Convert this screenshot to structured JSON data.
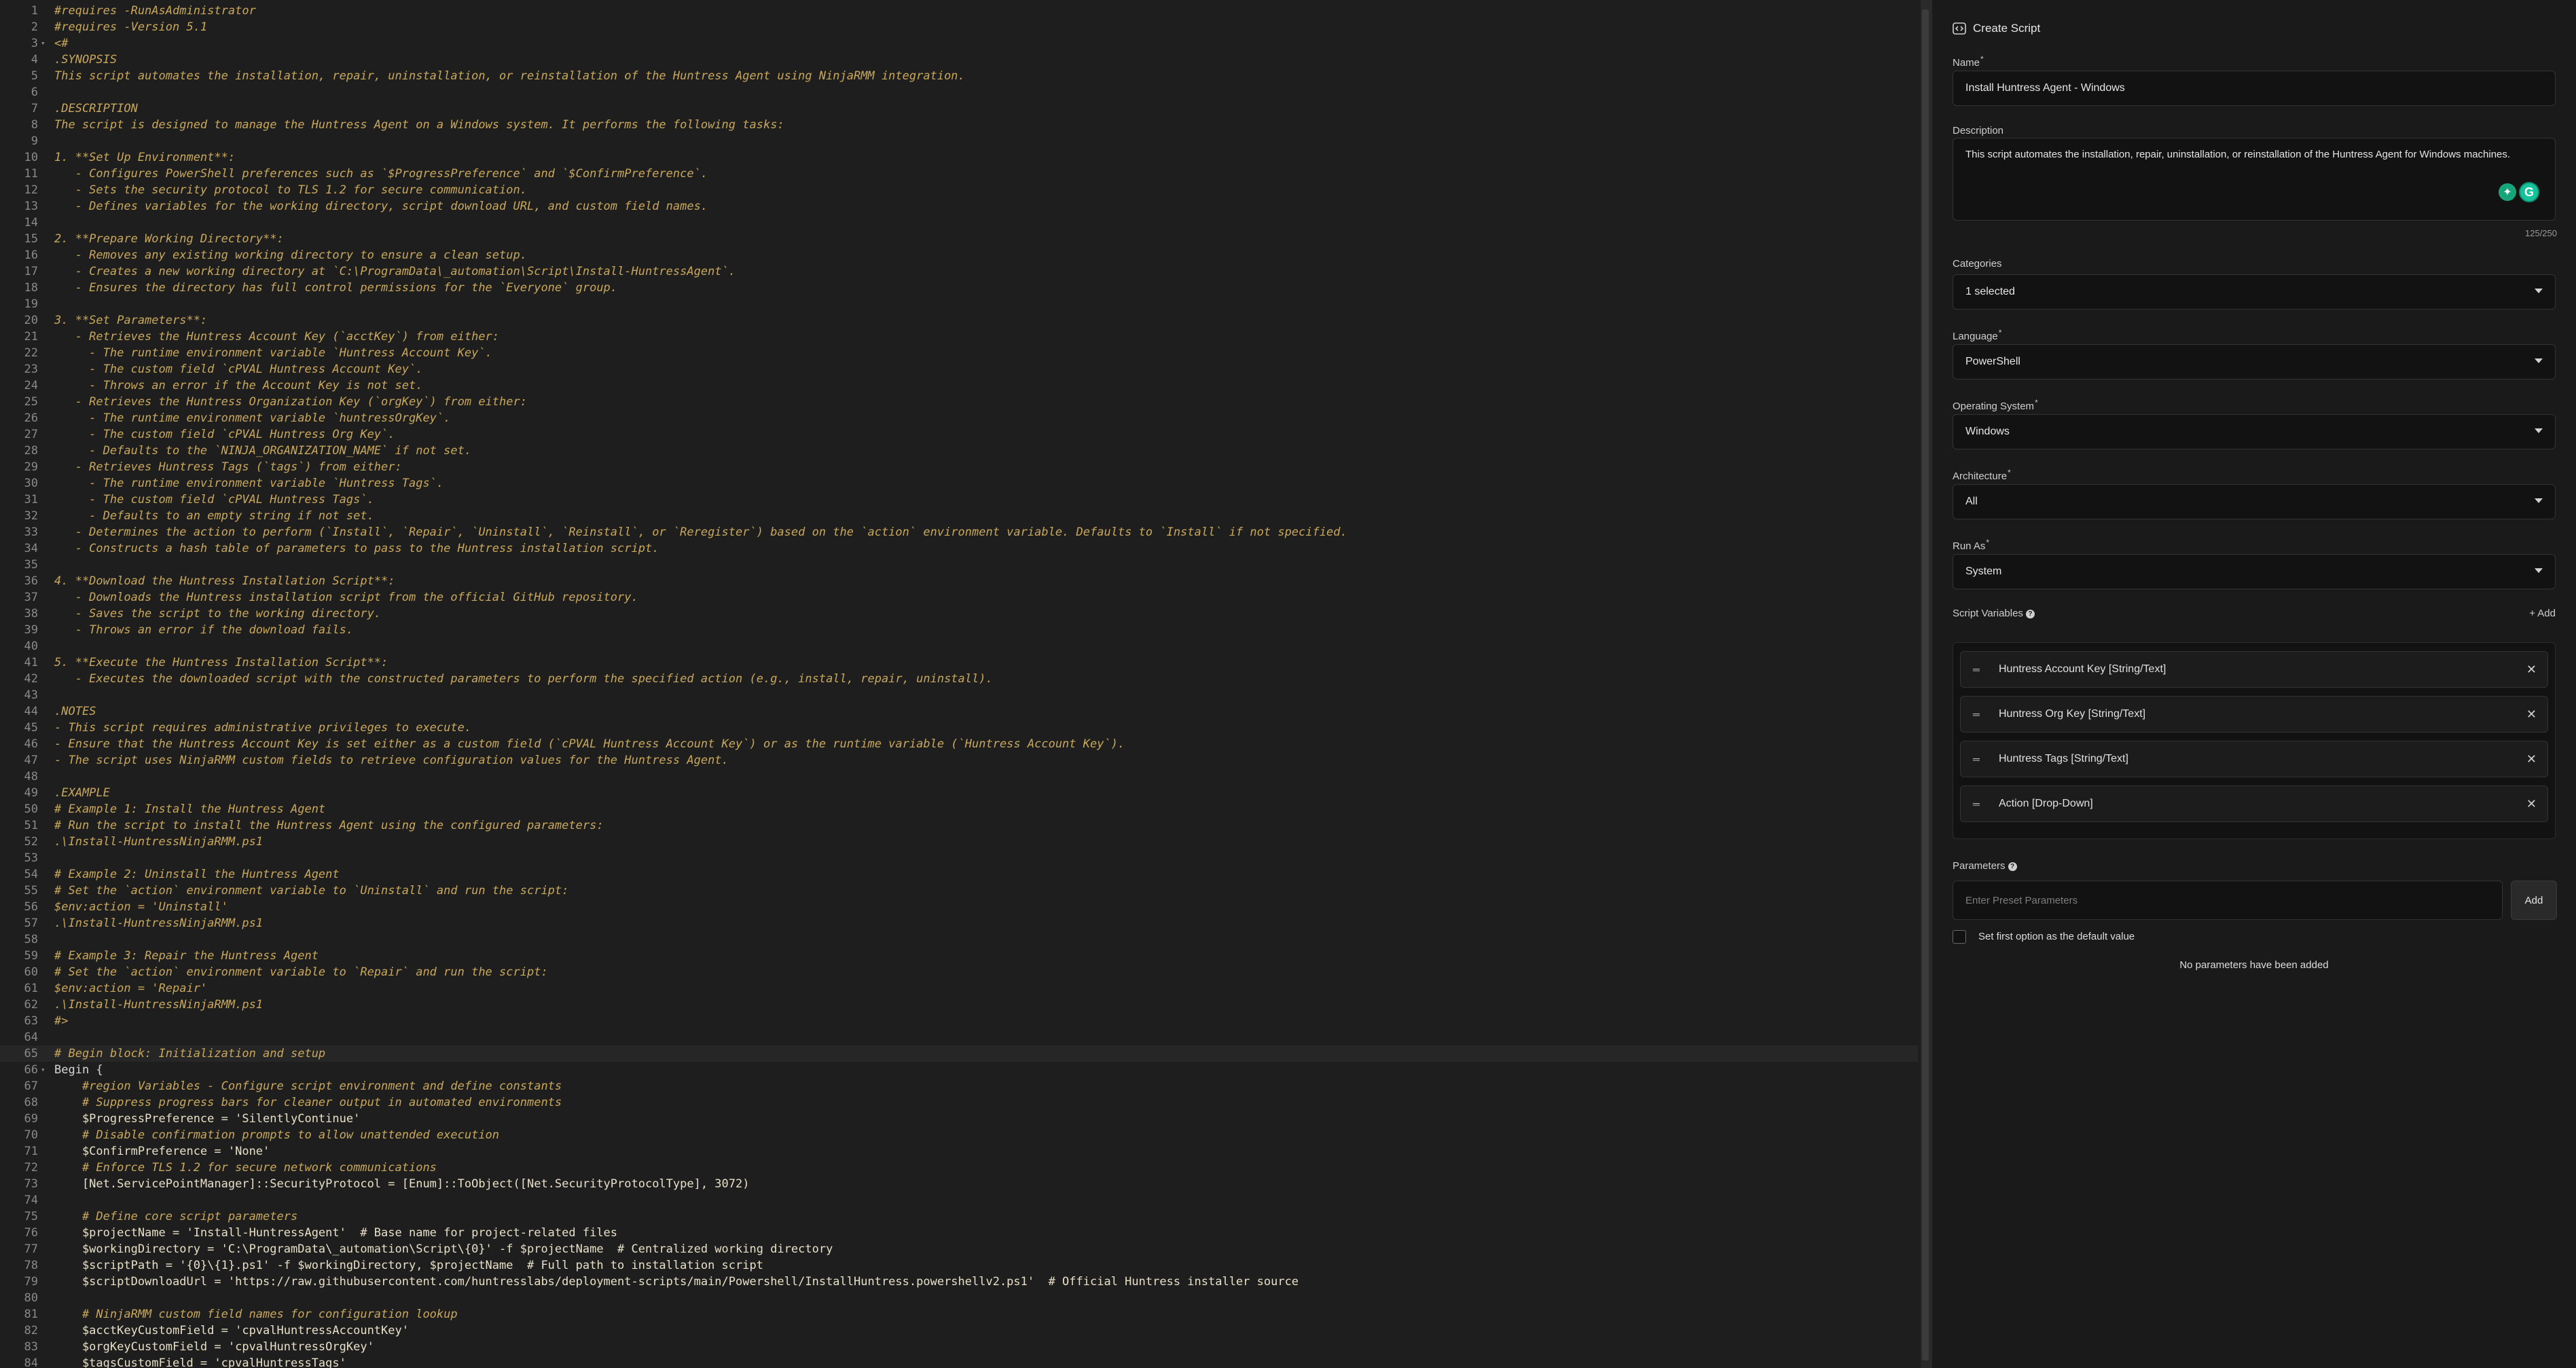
{
  "code_lines": [
    {
      "n": "1",
      "t": "#requires -RunAsAdministrator",
      "cls": "c"
    },
    {
      "n": "2",
      "t": "#requires -Version 5.1",
      "cls": "c"
    },
    {
      "n": "3",
      "t": "<#",
      "cls": "c",
      "fold": true
    },
    {
      "n": "4",
      "t": ".SYNOPSIS",
      "cls": "c"
    },
    {
      "n": "5",
      "t": "This script automates the installation, repair, uninstallation, or reinstallation of the Huntress Agent using NinjaRMM integration.",
      "cls": "c"
    },
    {
      "n": "6",
      "t": "",
      "cls": "c"
    },
    {
      "n": "7",
      "t": ".DESCRIPTION",
      "cls": "c"
    },
    {
      "n": "8",
      "t": "The script is designed to manage the Huntress Agent on a Windows system. It performs the following tasks:",
      "cls": "c"
    },
    {
      "n": "9",
      "t": "",
      "cls": "c"
    },
    {
      "n": "10",
      "t": "1. **Set Up Environment**:",
      "cls": "c"
    },
    {
      "n": "11",
      "t": "   - Configures PowerShell preferences such as `$ProgressPreference` and `$ConfirmPreference`.",
      "cls": "c"
    },
    {
      "n": "12",
      "t": "   - Sets the security protocol to TLS 1.2 for secure communication.",
      "cls": "c"
    },
    {
      "n": "13",
      "t": "   - Defines variables for the working directory, script download URL, and custom field names.",
      "cls": "c"
    },
    {
      "n": "14",
      "t": "",
      "cls": "c"
    },
    {
      "n": "15",
      "t": "2. **Prepare Working Directory**:",
      "cls": "c"
    },
    {
      "n": "16",
      "t": "   - Removes any existing working directory to ensure a clean setup.",
      "cls": "c"
    },
    {
      "n": "17",
      "t": "   - Creates a new working directory at `C:\\ProgramData\\_automation\\Script\\Install-HuntressAgent`.",
      "cls": "c"
    },
    {
      "n": "18",
      "t": "   - Ensures the directory has full control permissions for the `Everyone` group.",
      "cls": "c"
    },
    {
      "n": "19",
      "t": "",
      "cls": "c"
    },
    {
      "n": "20",
      "t": "3. **Set Parameters**:",
      "cls": "c"
    },
    {
      "n": "21",
      "t": "   - Retrieves the Huntress Account Key (`acctKey`) from either:",
      "cls": "c"
    },
    {
      "n": "22",
      "t": "     - The runtime environment variable `Huntress Account Key`.",
      "cls": "c"
    },
    {
      "n": "23",
      "t": "     - The custom field `cPVAL Huntress Account Key`.",
      "cls": "c"
    },
    {
      "n": "24",
      "t": "     - Throws an error if the Account Key is not set.",
      "cls": "c"
    },
    {
      "n": "25",
      "t": "   - Retrieves the Huntress Organization Key (`orgKey`) from either:",
      "cls": "c"
    },
    {
      "n": "26",
      "t": "     - The runtime environment variable `huntressOrgKey`.",
      "cls": "c"
    },
    {
      "n": "27",
      "t": "     - The custom field `cPVAL Huntress Org Key`.",
      "cls": "c"
    },
    {
      "n": "28",
      "t": "     - Defaults to the `NINJA_ORGANIZATION_NAME` if not set.",
      "cls": "c"
    },
    {
      "n": "29",
      "t": "   - Retrieves Huntress Tags (`tags`) from either:",
      "cls": "c"
    },
    {
      "n": "30",
      "t": "     - The runtime environment variable `Huntress Tags`.",
      "cls": "c"
    },
    {
      "n": "31",
      "t": "     - The custom field `cPVAL Huntress Tags`.",
      "cls": "c"
    },
    {
      "n": "32",
      "t": "     - Defaults to an empty string if not set.",
      "cls": "c"
    },
    {
      "n": "33",
      "t": "   - Determines the action to perform (`Install`, `Repair`, `Uninstall`, `Reinstall`, or `Reregister`) based on the `action` environment variable. Defaults to `Install` if not specified.",
      "cls": "c"
    },
    {
      "n": "34",
      "t": "   - Constructs a hash table of parameters to pass to the Huntress installation script.",
      "cls": "c"
    },
    {
      "n": "35",
      "t": "",
      "cls": "c"
    },
    {
      "n": "36",
      "t": "4. **Download the Huntress Installation Script**:",
      "cls": "c"
    },
    {
      "n": "37",
      "t": "   - Downloads the Huntress installation script from the official GitHub repository.",
      "cls": "c"
    },
    {
      "n": "38",
      "t": "   - Saves the script to the working directory.",
      "cls": "c"
    },
    {
      "n": "39",
      "t": "   - Throws an error if the download fails.",
      "cls": "c"
    },
    {
      "n": "40",
      "t": "",
      "cls": "c"
    },
    {
      "n": "41",
      "t": "5. **Execute the Huntress Installation Script**:",
      "cls": "c"
    },
    {
      "n": "42",
      "t": "   - Executes the downloaded script with the constructed parameters to perform the specified action (e.g., install, repair, uninstall).",
      "cls": "c"
    },
    {
      "n": "43",
      "t": "",
      "cls": "c"
    },
    {
      "n": "44",
      "t": ".NOTES",
      "cls": "c"
    },
    {
      "n": "45",
      "t": "- This script requires administrative privileges to execute.",
      "cls": "c"
    },
    {
      "n": "46",
      "t": "- Ensure that the Huntress Account Key is set either as a custom field (`cPVAL Huntress Account Key`) or as the runtime variable (`Huntress Account Key`).",
      "cls": "c"
    },
    {
      "n": "47",
      "t": "- The script uses NinjaRMM custom fields to retrieve configuration values for the Huntress Agent.",
      "cls": "c"
    },
    {
      "n": "48",
      "t": "",
      "cls": "c"
    },
    {
      "n": "49",
      "t": ".EXAMPLE",
      "cls": "c"
    },
    {
      "n": "50",
      "t": "# Example 1: Install the Huntress Agent",
      "cls": "c"
    },
    {
      "n": "51",
      "t": "# Run the script to install the Huntress Agent using the configured parameters:",
      "cls": "c"
    },
    {
      "n": "52",
      "t": ".\\Install-HuntressNinjaRMM.ps1",
      "cls": "c"
    },
    {
      "n": "53",
      "t": "",
      "cls": "c"
    },
    {
      "n": "54",
      "t": "# Example 2: Uninstall the Huntress Agent",
      "cls": "c"
    },
    {
      "n": "55",
      "t": "# Set the `action` environment variable to `Uninstall` and run the script:",
      "cls": "c"
    },
    {
      "n": "56",
      "t": "$env:action = 'Uninstall'",
      "cls": "c"
    },
    {
      "n": "57",
      "t": ".\\Install-HuntressNinjaRMM.ps1",
      "cls": "c"
    },
    {
      "n": "58",
      "t": "",
      "cls": "c"
    },
    {
      "n": "59",
      "t": "# Example 3: Repair the Huntress Agent",
      "cls": "c"
    },
    {
      "n": "60",
      "t": "# Set the `action` environment variable to `Repair` and run the script:",
      "cls": "c"
    },
    {
      "n": "61",
      "t": "$env:action = 'Repair'",
      "cls": "c"
    },
    {
      "n": "62",
      "t": ".\\Install-HuntressNinjaRMM.ps1",
      "cls": "c"
    },
    {
      "n": "63",
      "t": "#>",
      "cls": "c"
    },
    {
      "n": "64",
      "t": "",
      "cls": "c"
    },
    {
      "n": "65",
      "t": "# Begin block: Initialization and setup",
      "cls": "c",
      "active": true
    },
    {
      "n": "66",
      "t": "Begin {",
      "cls": "k",
      "fold": true
    },
    {
      "n": "67",
      "t": "    #region Variables - Configure script environment and define constants",
      "cls": "c"
    },
    {
      "n": "68",
      "t": "    # Suppress progress bars for cleaner output in automated environments",
      "cls": "c"
    },
    {
      "n": "69",
      "t": "    $ProgressPreference = 'SilentlyContinue'",
      "cls": "v"
    },
    {
      "n": "70",
      "t": "    # Disable confirmation prompts to allow unattended execution",
      "cls": "c"
    },
    {
      "n": "71",
      "t": "    $ConfirmPreference = 'None'",
      "cls": "v"
    },
    {
      "n": "72",
      "t": "    # Enforce TLS 1.2 for secure network communications",
      "cls": "c"
    },
    {
      "n": "73",
      "t": "    [Net.ServicePointManager]::SecurityProtocol = [Enum]::ToObject([Net.SecurityProtocolType], 3072)",
      "cls": "v"
    },
    {
      "n": "74",
      "t": "",
      "cls": "v"
    },
    {
      "n": "75",
      "t": "    # Define core script parameters",
      "cls": "c"
    },
    {
      "n": "76",
      "t": "    $projectName = 'Install-HuntressAgent'  # Base name for project-related files",
      "cls": "v"
    },
    {
      "n": "77",
      "t": "    $workingDirectory = 'C:\\ProgramData\\_automation\\Script\\{0}' -f $projectName  # Centralized working directory",
      "cls": "v"
    },
    {
      "n": "78",
      "t": "    $scriptPath = '{0}\\{1}.ps1' -f $workingDirectory, $projectName  # Full path to installation script",
      "cls": "v"
    },
    {
      "n": "79",
      "t": "    $scriptDownloadUrl = 'https://raw.githubusercontent.com/huntresslabs/deployment-scripts/main/Powershell/InstallHuntress.powershellv2.ps1'  # Official Huntress installer source",
      "cls": "v"
    },
    {
      "n": "80",
      "t": "",
      "cls": "v"
    },
    {
      "n": "81",
      "t": "    # NinjaRMM custom field names for configuration lookup",
      "cls": "c"
    },
    {
      "n": "82",
      "t": "    $acctKeyCustomField = 'cpvalHuntressAccountKey'",
      "cls": "v"
    },
    {
      "n": "83",
      "t": "    $orgKeyCustomField = 'cpvalHuntressOrgKey'",
      "cls": "v"
    },
    {
      "n": "84",
      "t": "    $tagsCustomField = 'cpvalHuntressTags'",
      "cls": "v"
    }
  ],
  "panel": {
    "title": "Create Script",
    "name_label": "Name",
    "name_value": "Install Huntress Agent - Windows",
    "description_label": "Description",
    "description_value": "This script automates the installation, repair, uninstallation, or reinstallation of the Huntress Agent for Windows machines.",
    "description_counter": "125/250",
    "categories_label": "Categories",
    "categories_value": "1 selected",
    "language_label": "Language",
    "language_value": "PowerShell",
    "os_label": "Operating System",
    "os_value": "Windows",
    "arch_label": "Architecture",
    "arch_value": "All",
    "runas_label": "Run As",
    "runas_value": "System",
    "script_vars_label": "Script Variables",
    "add_label": "+ Add",
    "script_vars": [
      "Huntress Account Key [String/Text]",
      "Huntress Org Key [String/Text]",
      "Huntress Tags [String/Text]",
      "Action [Drop-Down]"
    ],
    "parameters_label": "Parameters",
    "parameters_placeholder": "Enter Preset Parameters",
    "parameters_add": "Add",
    "default_checkbox_label": "Set first option as the default value",
    "empty_parameters": "No parameters have been added"
  },
  "colors": {
    "comment": "#c9a85c",
    "background": "#1e1e1e",
    "panel_background": "#1a1a1a",
    "grammarly": "#15c39a"
  }
}
